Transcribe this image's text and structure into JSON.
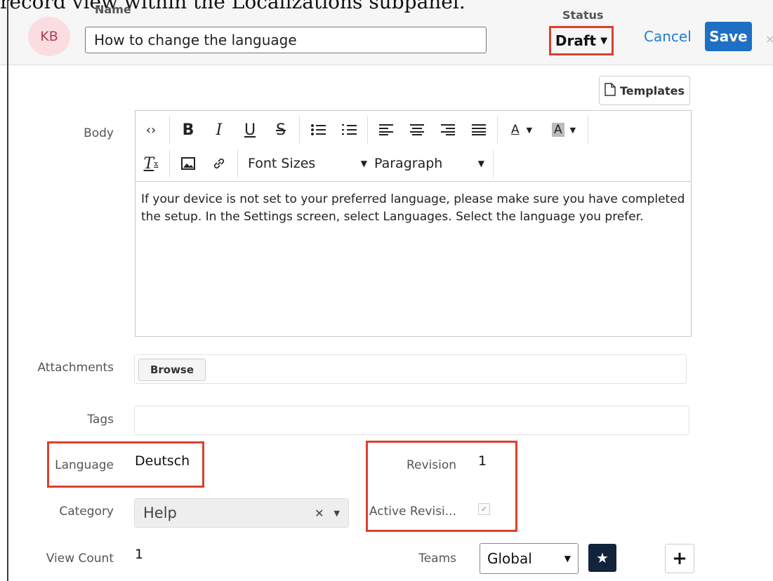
{
  "caption": "record view within the Localizations subpanel.",
  "header": {
    "avatar_initials": "KB",
    "name_label": "Name",
    "name_value": "How to change the language",
    "status_label": "Status",
    "status_value": "Draft",
    "cancel_label": "Cancel",
    "save_label": "Save",
    "close_glyph": "×"
  },
  "templates_label": "Templates",
  "body": {
    "label": "Body",
    "toolbar": {
      "font_sizes": "Font Sizes",
      "paragraph": "Paragraph",
      "bold": "B",
      "italic": "I",
      "underline": "U",
      "strike": "S"
    },
    "text": "If your device is not set to your preferred language, please make sure you have completed the setup. In the Settings screen, select Languages. Select the language you prefer."
  },
  "attachments": {
    "label": "Attachments",
    "browse_label": "Browse"
  },
  "tags": {
    "label": "Tags"
  },
  "language": {
    "label": "Language",
    "value": "Deutsch"
  },
  "revision": {
    "label": "Revision",
    "value": "1"
  },
  "category": {
    "label": "Category",
    "value": "Help"
  },
  "active_revision": {
    "label": "Active Revisi...",
    "checked": true
  },
  "view_count": {
    "label": "View Count",
    "value": "1"
  },
  "teams": {
    "label": "Teams",
    "value": "Global"
  },
  "colors": {
    "accent": "#1f6fc5",
    "highlight": "#d9412f",
    "avatar_bg": "#fbdde1"
  }
}
